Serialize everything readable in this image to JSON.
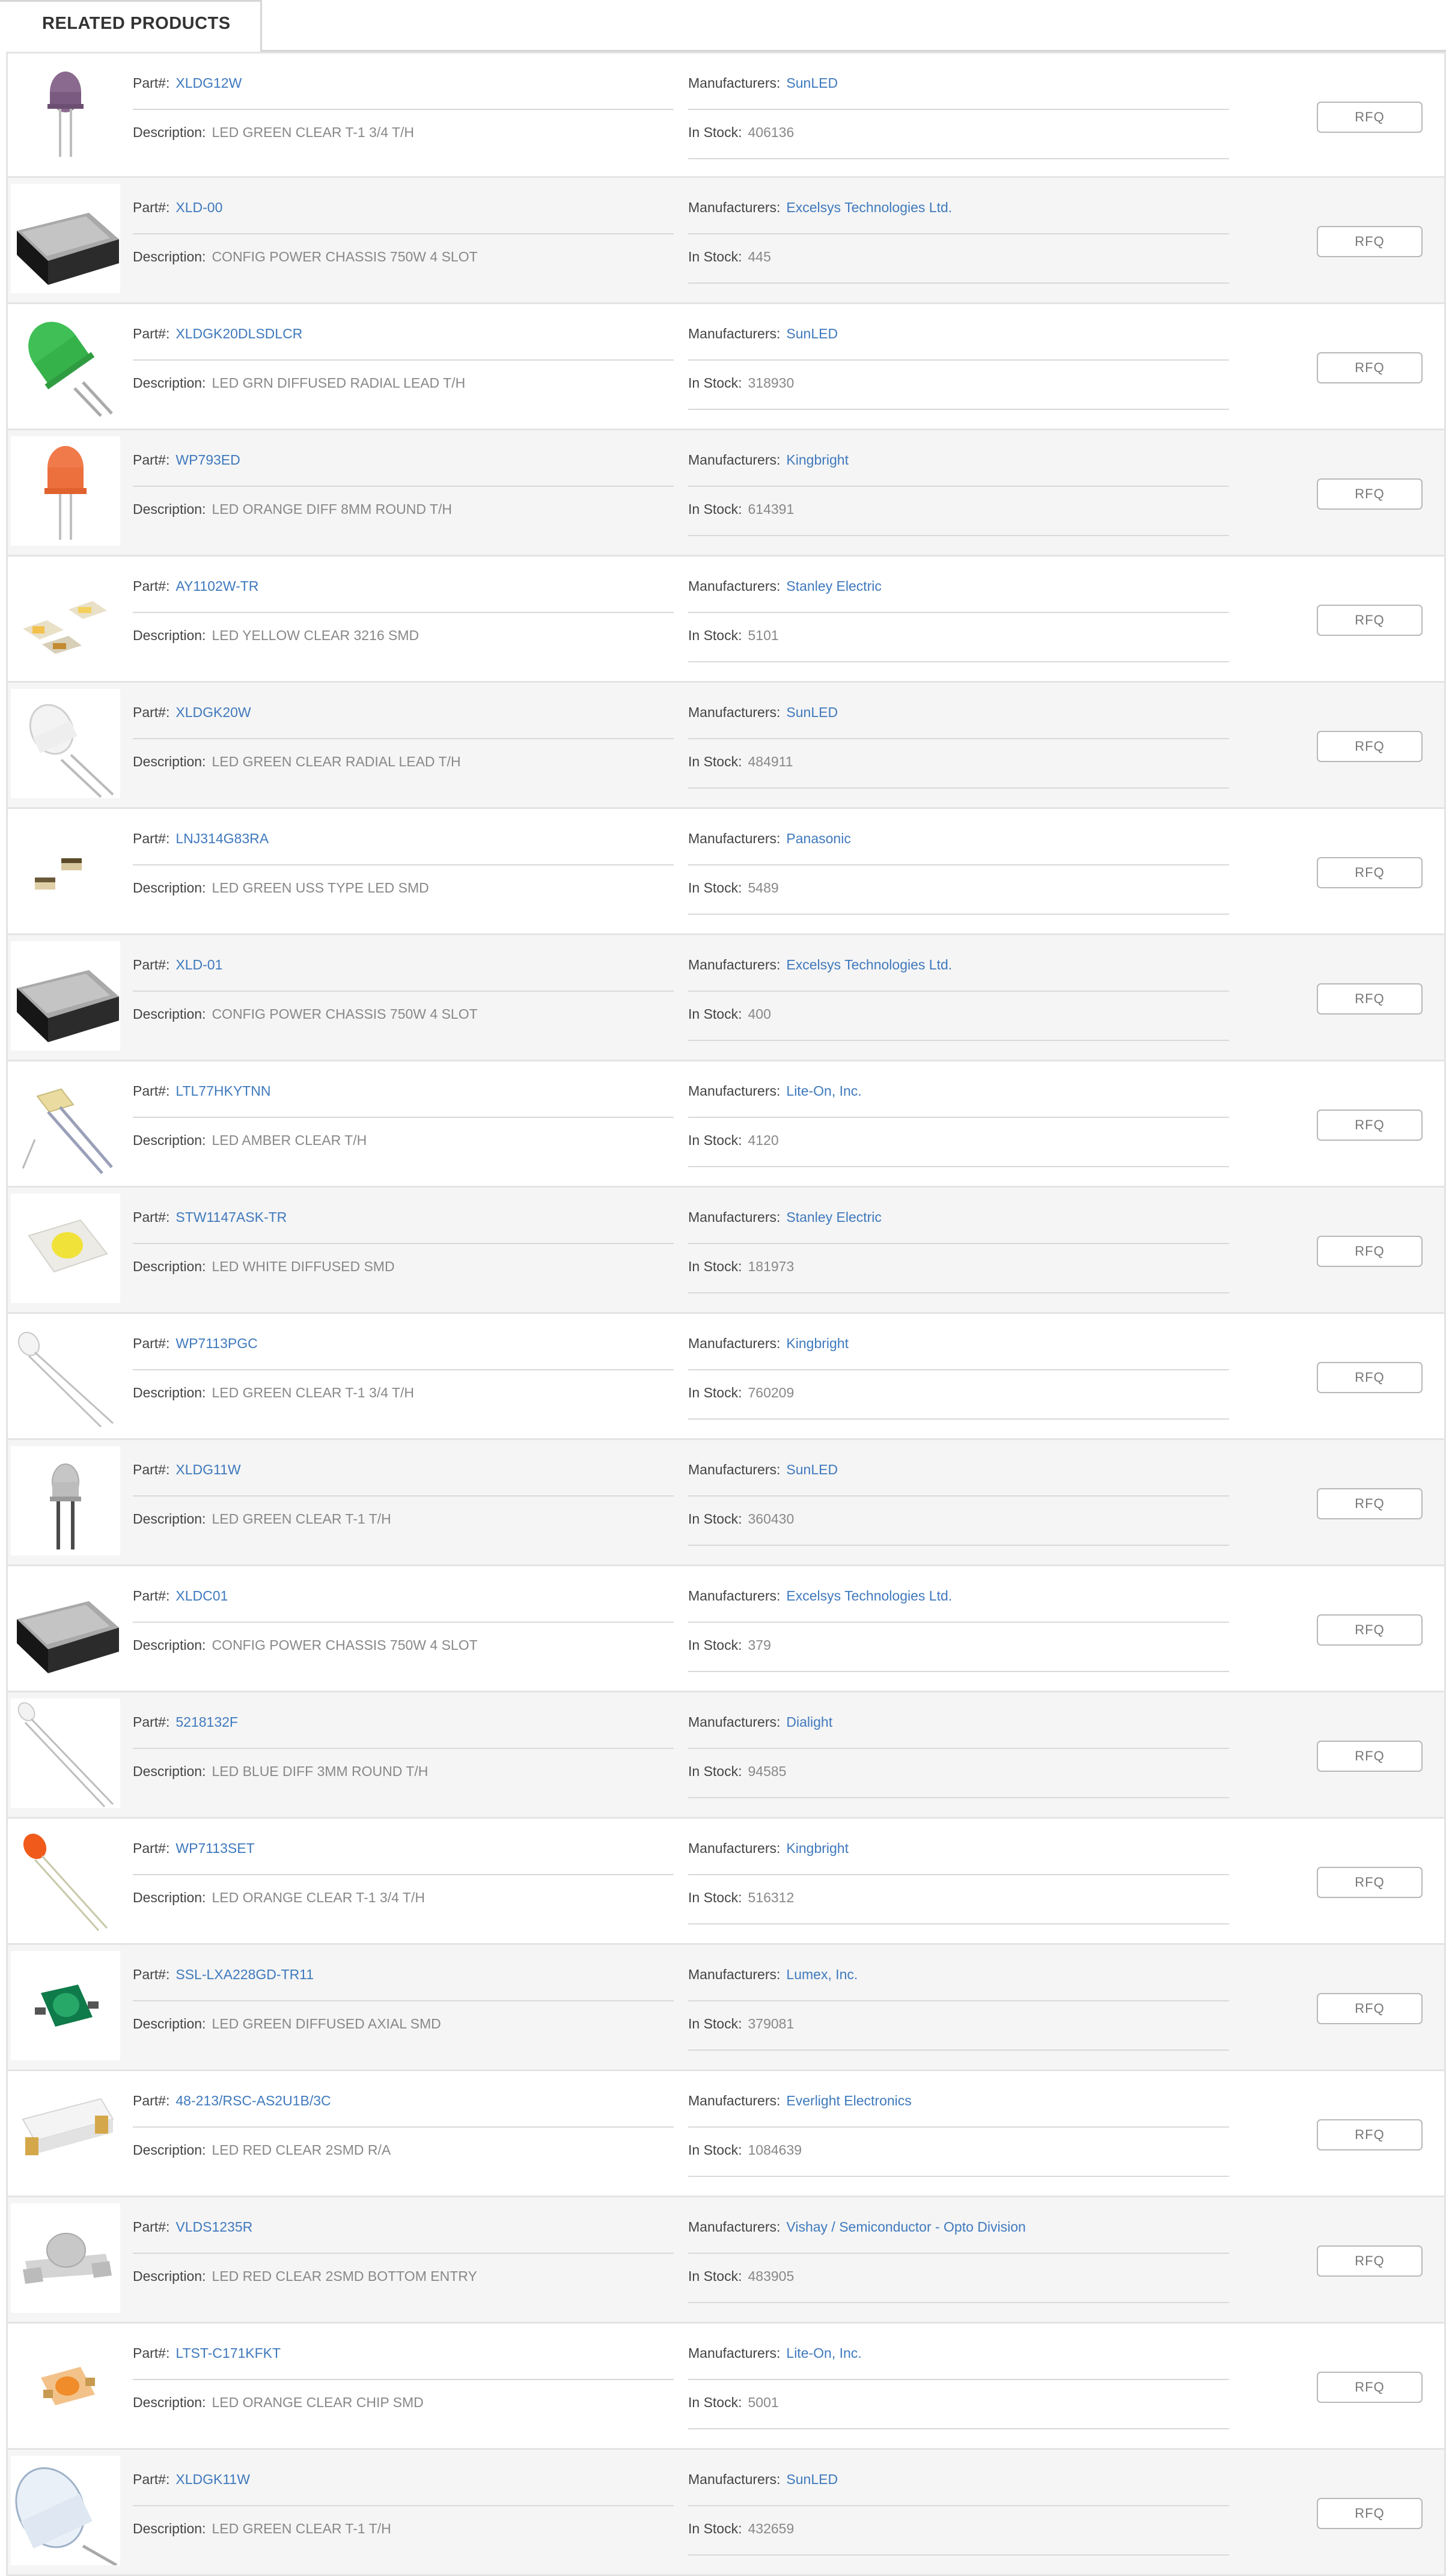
{
  "tab": {
    "title": "RELATED PRODUCTS"
  },
  "labels": {
    "part": "Part#:",
    "manufacturer": "Manufacturers:",
    "description": "Description:",
    "stock": "In Stock:",
    "rfq": "RFQ"
  },
  "colors": {
    "link": "#3f79bd",
    "row_alt_bg": "#f5f5f5",
    "border": "#e4e4e4"
  },
  "products": [
    {
      "part": "XLDG12W",
      "manufacturer": "SunLED",
      "description": "LED GREEN CLEAR T-1 3/4 T/H",
      "stock": "406136",
      "icon": "led-purple-icon"
    },
    {
      "part": "XLD-00",
      "manufacturer": "Excelsys Technologies Ltd.",
      "description": "CONFIG POWER CHASSIS 750W 4 SLOT",
      "stock": "445",
      "icon": "power-chassis-icon"
    },
    {
      "part": "XLDGK20DLSDLCR",
      "manufacturer": "SunLED",
      "description": "LED GRN DIFFUSED RADIAL LEAD T/H",
      "stock": "318930",
      "icon": "led-green-diffused-icon"
    },
    {
      "part": "WP793ED",
      "manufacturer": "Kingbright",
      "description": "LED ORANGE DIFF 8MM ROUND T/H",
      "stock": "614391",
      "icon": "led-orange-icon"
    },
    {
      "part": "AY1102W-TR",
      "manufacturer": "Stanley Electric",
      "description": "LED YELLOW CLEAR 3216 SMD",
      "stock": "5101",
      "icon": "smd-led-yellow-icon"
    },
    {
      "part": "XLDGK20W",
      "manufacturer": "SunLED",
      "description": "LED GREEN CLEAR RADIAL LEAD T/H",
      "stock": "484911",
      "icon": "led-clear-icon"
    },
    {
      "part": "LNJ314G83RA",
      "manufacturer": "Panasonic",
      "description": "LED GREEN USS TYPE LED SMD",
      "stock": "5489",
      "icon": "smd-chip-icon"
    },
    {
      "part": "XLD-01",
      "manufacturer": "Excelsys Technologies Ltd.",
      "description": "CONFIG POWER CHASSIS 750W 4 SLOT",
      "stock": "400",
      "icon": "power-chassis-icon"
    },
    {
      "part": "LTL77HKYTNN",
      "manufacturer": "Lite-On, Inc.",
      "description": "LED AMBER CLEAR T/H",
      "stock": "4120",
      "icon": "led-amber-icon"
    },
    {
      "part": "STW1147ASK-TR",
      "manufacturer": "Stanley Electric",
      "description": "LED WHITE DIFFUSED SMD",
      "stock": "181973",
      "icon": "smd-led-white-icon"
    },
    {
      "part": "WP7113PGC",
      "manufacturer": "Kingbright",
      "description": "LED GREEN CLEAR T-1 3/4 T/H",
      "stock": "760209",
      "icon": "led-small-clear-icon"
    },
    {
      "part": "XLDG11W",
      "manufacturer": "SunLED",
      "description": "LED GREEN CLEAR T-1 T/H",
      "stock": "360430",
      "icon": "led-gray-icon"
    },
    {
      "part": "XLDC01",
      "manufacturer": "Excelsys Technologies Ltd.",
      "description": "CONFIG POWER CHASSIS 750W 4 SLOT",
      "stock": "379",
      "icon": "power-chassis-icon"
    },
    {
      "part": "5218132F",
      "manufacturer": "Dialight",
      "description": "LED BLUE DIFF 3MM ROUND T/H",
      "stock": "94585",
      "icon": "led-small-white-icon"
    },
    {
      "part": "WP7113SET",
      "manufacturer": "Kingbright",
      "description": "LED ORANGE CLEAR T-1 3/4 T/H",
      "stock": "516312",
      "icon": "led-small-orange-icon"
    },
    {
      "part": "SSL-LXA228GD-TR11",
      "manufacturer": "Lumex, Inc.",
      "description": "LED GREEN DIFFUSED AXIAL SMD",
      "stock": "379081",
      "icon": "smd-led-green-icon"
    },
    {
      "part": "48-213/RSC-AS2U1B/3C",
      "manufacturer": "Everlight Electronics",
      "description": "LED RED CLEAR 2SMD R/A",
      "stock": "1084639",
      "icon": "smd-right-angle-icon"
    },
    {
      "part": "VLDS1235R",
      "manufacturer": "Vishay / Semiconductor - Opto Division",
      "description": "LED RED CLEAR 2SMD BOTTOM ENTRY",
      "stock": "483905",
      "icon": "smd-dome-icon"
    },
    {
      "part": "LTST-C171KFKT",
      "manufacturer": "Lite-On, Inc.",
      "description": "LED ORANGE CLEAR CHIP SMD",
      "stock": "5001",
      "icon": "smd-led-orange-icon"
    },
    {
      "part": "XLDGK11W",
      "manufacturer": "SunLED",
      "description": "LED GREEN CLEAR T-1 T/H",
      "stock": "432659",
      "icon": "led-large-clear-icon"
    }
  ]
}
